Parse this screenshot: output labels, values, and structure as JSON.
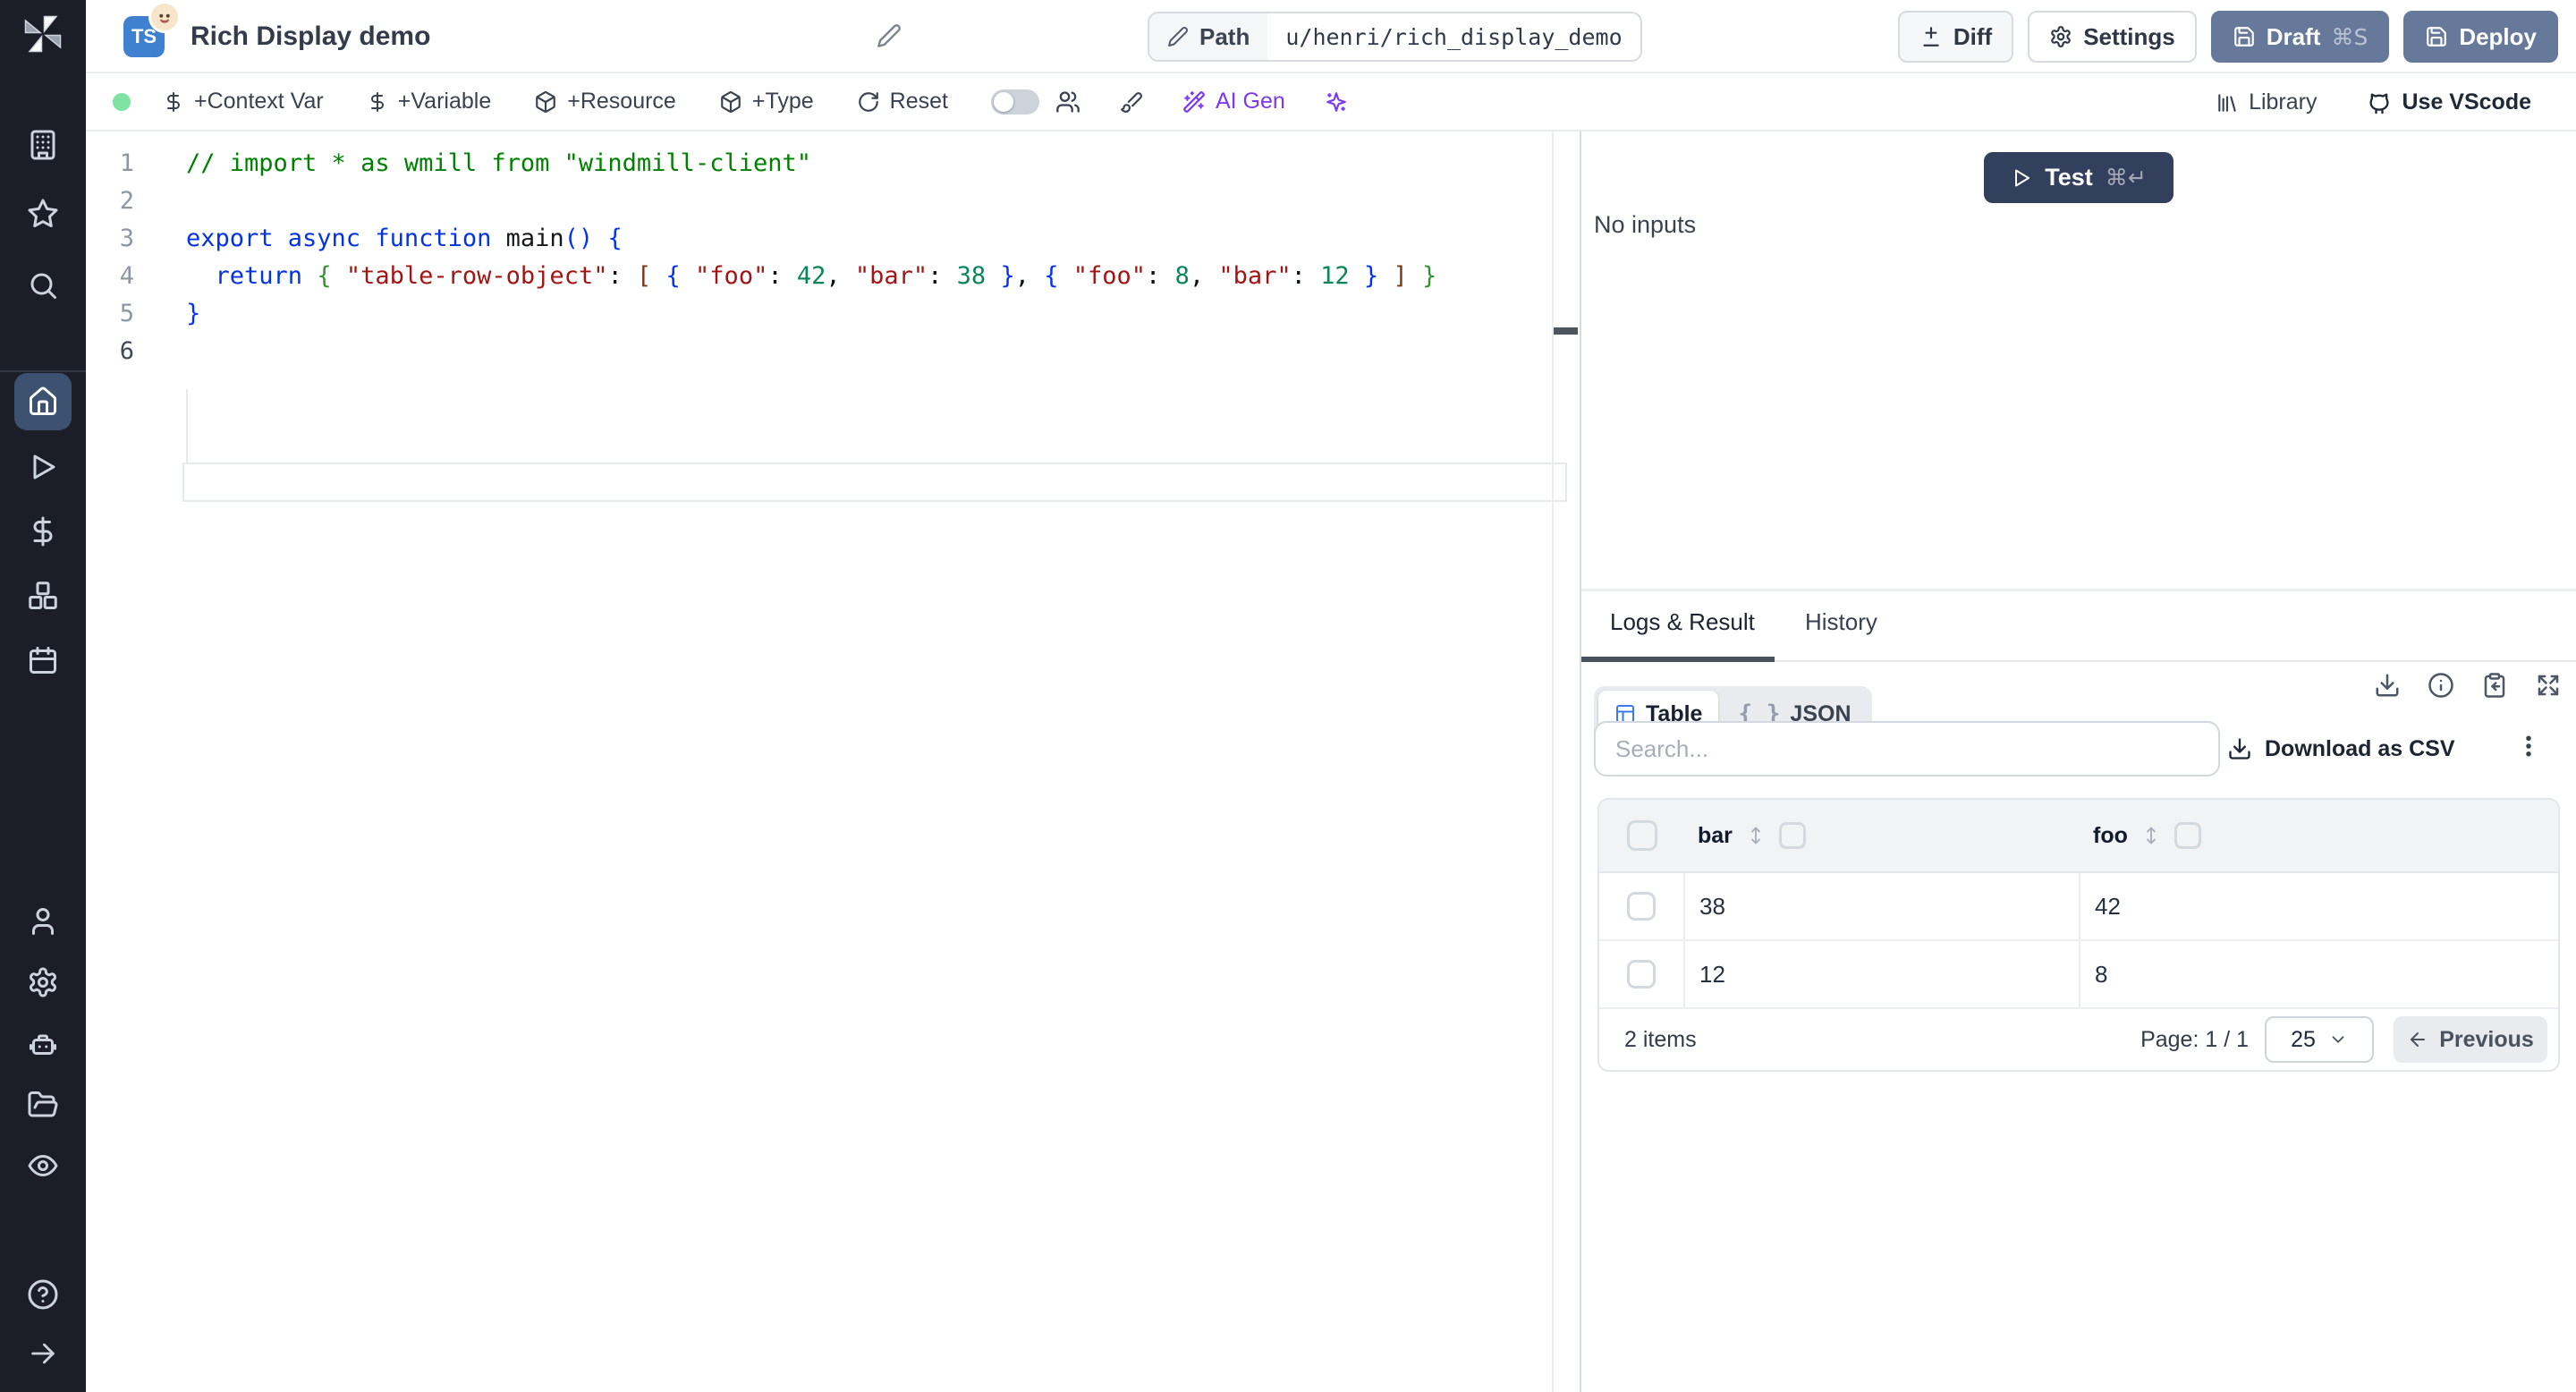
{
  "header": {
    "language_badge": "TS",
    "title": "Rich Display demo",
    "path": {
      "label": "Path",
      "value": "u/henri/rich_display_demo"
    },
    "actions": {
      "diff": "Diff",
      "settings": "Settings",
      "draft": "Draft",
      "draft_shortcut": "⌘S",
      "deploy": "Deploy"
    }
  },
  "toolbar": {
    "context_var": "+Context Var",
    "variable": "+Variable",
    "resource": "+Resource",
    "type": "+Type",
    "reset": "Reset",
    "ai_gen": "AI Gen",
    "library": "Library",
    "vscode": "Use VScode"
  },
  "editor": {
    "lines": [
      {
        "n": "1",
        "tokens": [
          {
            "c": "comment",
            "t": "// import * as wmill from \"windmill-client\""
          }
        ]
      },
      {
        "n": "2",
        "tokens": []
      },
      {
        "n": "3",
        "tokens": [
          {
            "c": "kw",
            "t": "export async function "
          },
          {
            "c": "fn",
            "t": "main"
          },
          {
            "c": "b1",
            "t": "()"
          },
          {
            "c": "pl",
            "t": " "
          },
          {
            "c": "b1",
            "t": "{"
          }
        ]
      },
      {
        "n": "4",
        "tokens": [
          {
            "c": "pl",
            "t": "  "
          },
          {
            "c": "kw",
            "t": "return"
          },
          {
            "c": "pl",
            "t": " "
          },
          {
            "c": "b2",
            "t": "{"
          },
          {
            "c": "pl",
            "t": " "
          },
          {
            "c": "str",
            "t": "\"table-row-object\""
          },
          {
            "c": "pl",
            "t": ": "
          },
          {
            "c": "b3",
            "t": "["
          },
          {
            "c": "pl",
            "t": " "
          },
          {
            "c": "b1",
            "t": "{"
          },
          {
            "c": "pl",
            "t": " "
          },
          {
            "c": "str",
            "t": "\"foo\""
          },
          {
            "c": "pl",
            "t": ": "
          },
          {
            "c": "num",
            "t": "42"
          },
          {
            "c": "pl",
            "t": ", "
          },
          {
            "c": "str",
            "t": "\"bar\""
          },
          {
            "c": "pl",
            "t": ": "
          },
          {
            "c": "num",
            "t": "38"
          },
          {
            "c": "pl",
            "t": " "
          },
          {
            "c": "b1",
            "t": "}"
          },
          {
            "c": "pl",
            "t": ", "
          },
          {
            "c": "b1",
            "t": "{"
          },
          {
            "c": "pl",
            "t": " "
          },
          {
            "c": "str",
            "t": "\"foo\""
          },
          {
            "c": "pl",
            "t": ": "
          },
          {
            "c": "num",
            "t": "8"
          },
          {
            "c": "pl",
            "t": ", "
          },
          {
            "c": "str",
            "t": "\"bar\""
          },
          {
            "c": "pl",
            "t": ": "
          },
          {
            "c": "num",
            "t": "12"
          },
          {
            "c": "pl",
            "t": " "
          },
          {
            "c": "b1",
            "t": "}"
          },
          {
            "c": "pl",
            "t": " "
          },
          {
            "c": "b3",
            "t": "]"
          },
          {
            "c": "pl",
            "t": " "
          },
          {
            "c": "b2",
            "t": "}"
          }
        ]
      },
      {
        "n": "5",
        "tokens": [
          {
            "c": "b1",
            "t": "}"
          }
        ]
      },
      {
        "n": "6",
        "tokens": [],
        "active": true
      }
    ]
  },
  "inputs_panel": {
    "test": "Test",
    "test_shortcut": "⌘↵",
    "empty": "No inputs"
  },
  "result_panel": {
    "tabs": {
      "logs": "Logs & Result",
      "history": "History"
    },
    "views": {
      "table": "Table",
      "json": "JSON",
      "json_icon": "{ }"
    },
    "search_placeholder": "Search...",
    "download_csv": "Download as CSV",
    "table": {
      "columns": [
        "bar",
        "foo"
      ],
      "rows": [
        {
          "bar": "38",
          "foo": "42"
        },
        {
          "bar": "12",
          "foo": "8"
        }
      ],
      "summary": "2 items",
      "page": "Page: 1 / 1",
      "page_size": "25",
      "previous": "Previous"
    }
  },
  "icons": {
    "sidebar": [
      "windmill-logo",
      "buildings",
      "star",
      "search",
      "home",
      "play",
      "dollar-sign",
      "boxes",
      "calendar",
      "user",
      "settings",
      "bot",
      "folder-open",
      "eye",
      "help-circle",
      "expand-arrow"
    ],
    "result_toolbar": [
      "download",
      "info",
      "clipboard-import",
      "expand"
    ]
  },
  "colors": {
    "primary_button": "#66799b",
    "test_button": "#323f5d",
    "ai_accent": "#7c3aed",
    "ts_badge": "#4080d0",
    "status_dot": "#7ee2a2",
    "table_icon_accent": "#3d79f2",
    "sidebar_bg": "#1b1e26"
  }
}
